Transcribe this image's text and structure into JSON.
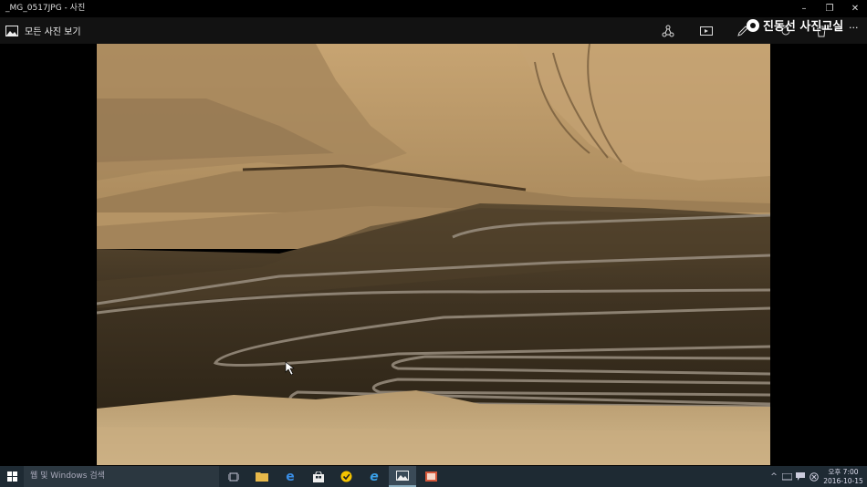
{
  "window": {
    "title": "_MG_0517JPG - 사진",
    "minimize_glyph": "–",
    "restore_glyph": "❐",
    "close_glyph": "✕"
  },
  "toolbar": {
    "all_photos_label": "모든 사진 보기",
    "icons": [
      "share-icon",
      "slideshow-icon",
      "edit-icon",
      "rotate-icon",
      "delete-icon"
    ],
    "more_glyph": "..."
  },
  "watermark": {
    "text": "진동선 사진교실"
  },
  "photo": {
    "description_colors": {
      "sky": "#c9a26a",
      "shadow": "#3b2f1d",
      "road": "#9a8f80"
    }
  },
  "taskbar": {
    "search_placeholder": "웹 및 Windows 검색",
    "apps": [
      "task-view-icon",
      "file-explorer-icon",
      "edge-icon",
      "store-icon",
      "norton-icon",
      "ie-icon",
      "photos-icon",
      "powerpoint-icon"
    ],
    "clock": {
      "time": "오후 7:00",
      "date": "2016-10-15"
    }
  }
}
